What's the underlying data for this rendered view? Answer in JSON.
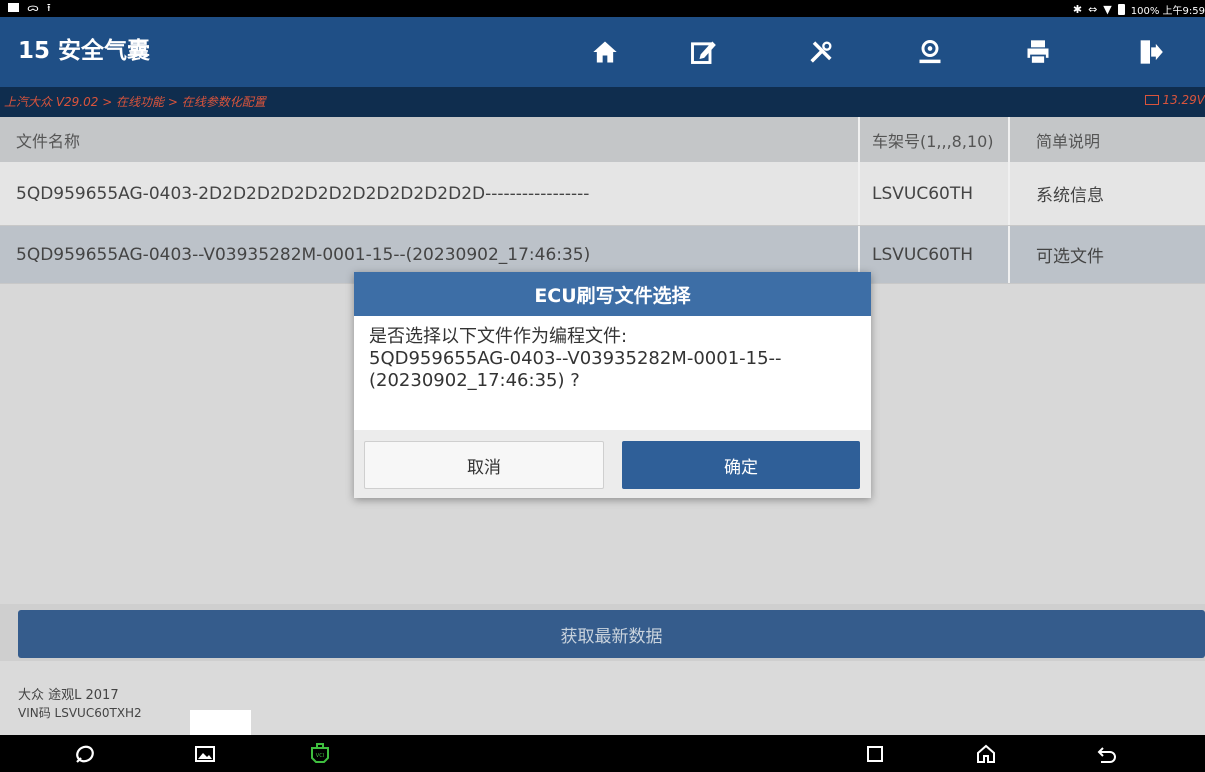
{
  "status_bar": {
    "right_text": "100% 上午9:59",
    "icons": [
      "image-icon",
      "voicemail-icon",
      "upload-icon",
      "bluetooth-icon",
      "data-transfer-icon",
      "wifi-icon",
      "battery-icon"
    ]
  },
  "header": {
    "title": "15 安全气囊",
    "toolbar_icons": [
      "home-icon",
      "edit-icon",
      "tools-icon",
      "user-icon",
      "print-icon",
      "exit-icon"
    ]
  },
  "breadcrumb": {
    "path": "上汽大众 V29.02 > 在线功能 > 在线参数化配置",
    "voltage": "13.29V"
  },
  "table": {
    "headers": [
      "文件名称",
      "车架号(1,,,8,10)",
      "简单说明"
    ],
    "rows": [
      [
        "5QD959655AG-0403-2D2D2D2D2D2D2D2D2D2D2D2D-----------------",
        "LSVUC60TH",
        "系统信息"
      ],
      [
        "5QD959655AG-0403--V03935282M-0001-15--(20230902_17:46:35)",
        "LSVUC60TH",
        "可选文件"
      ]
    ]
  },
  "get_data_label": "获取最新数据",
  "vehicle_info": {
    "model": "大众 途观L 2017",
    "vin": "VIN码 LSVUC60TXH2"
  },
  "dialog": {
    "title": "ECU刷写文件选择",
    "line1": "是否选择以下文件作为编程文件:",
    "line2": "5QD959655AG-0403--V03935282M-0001-15--",
    "line3": "(20230902_17:46:35) ?",
    "cancel_label": "取消",
    "ok_label": "确定"
  },
  "nav_icons": [
    "browser-icon",
    "gallery-icon",
    "vci-icon",
    "recent-apps-icon",
    "home-nav-icon",
    "back-icon"
  ],
  "colors": {
    "header_bg": "#1f4f86",
    "breadcrumb_bg": "#0f2d4e",
    "breadcrumb_text": "#d9543c",
    "dialog_title_bg": "#3d6ea6",
    "ok_button_bg": "#2f5f98",
    "vci_icon": "#3fbf3f"
  }
}
